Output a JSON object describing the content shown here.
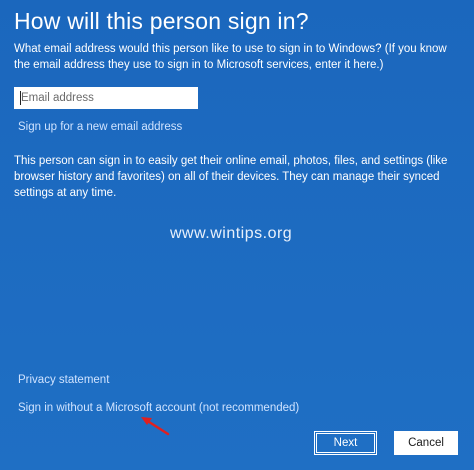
{
  "dialog": {
    "title": "How will this person sign in?",
    "intro": "What email address would this person like to use to sign in to Windows? (If you know the email address they use to sign in to Microsoft services, enter it here.)",
    "email": {
      "placeholder": "Email address",
      "value": ""
    },
    "signup_link": "Sign up for a new email address",
    "body": "This person can sign in to easily get their online email, photos, files, and settings (like browser history and favorites) on all of their devices. They can manage their synced settings at any time.",
    "watermark": "www.wintips.org",
    "privacy_link": "Privacy statement",
    "local_account_link": "Sign in without a Microsoft account (not recommended)",
    "next_label": "Next",
    "cancel_label": "Cancel"
  },
  "colors": {
    "background": "#1f6fc4",
    "link": "#cfe3ff",
    "arrow": "#e02020"
  },
  "icons": {
    "annotation": "red-arrow-icon"
  }
}
